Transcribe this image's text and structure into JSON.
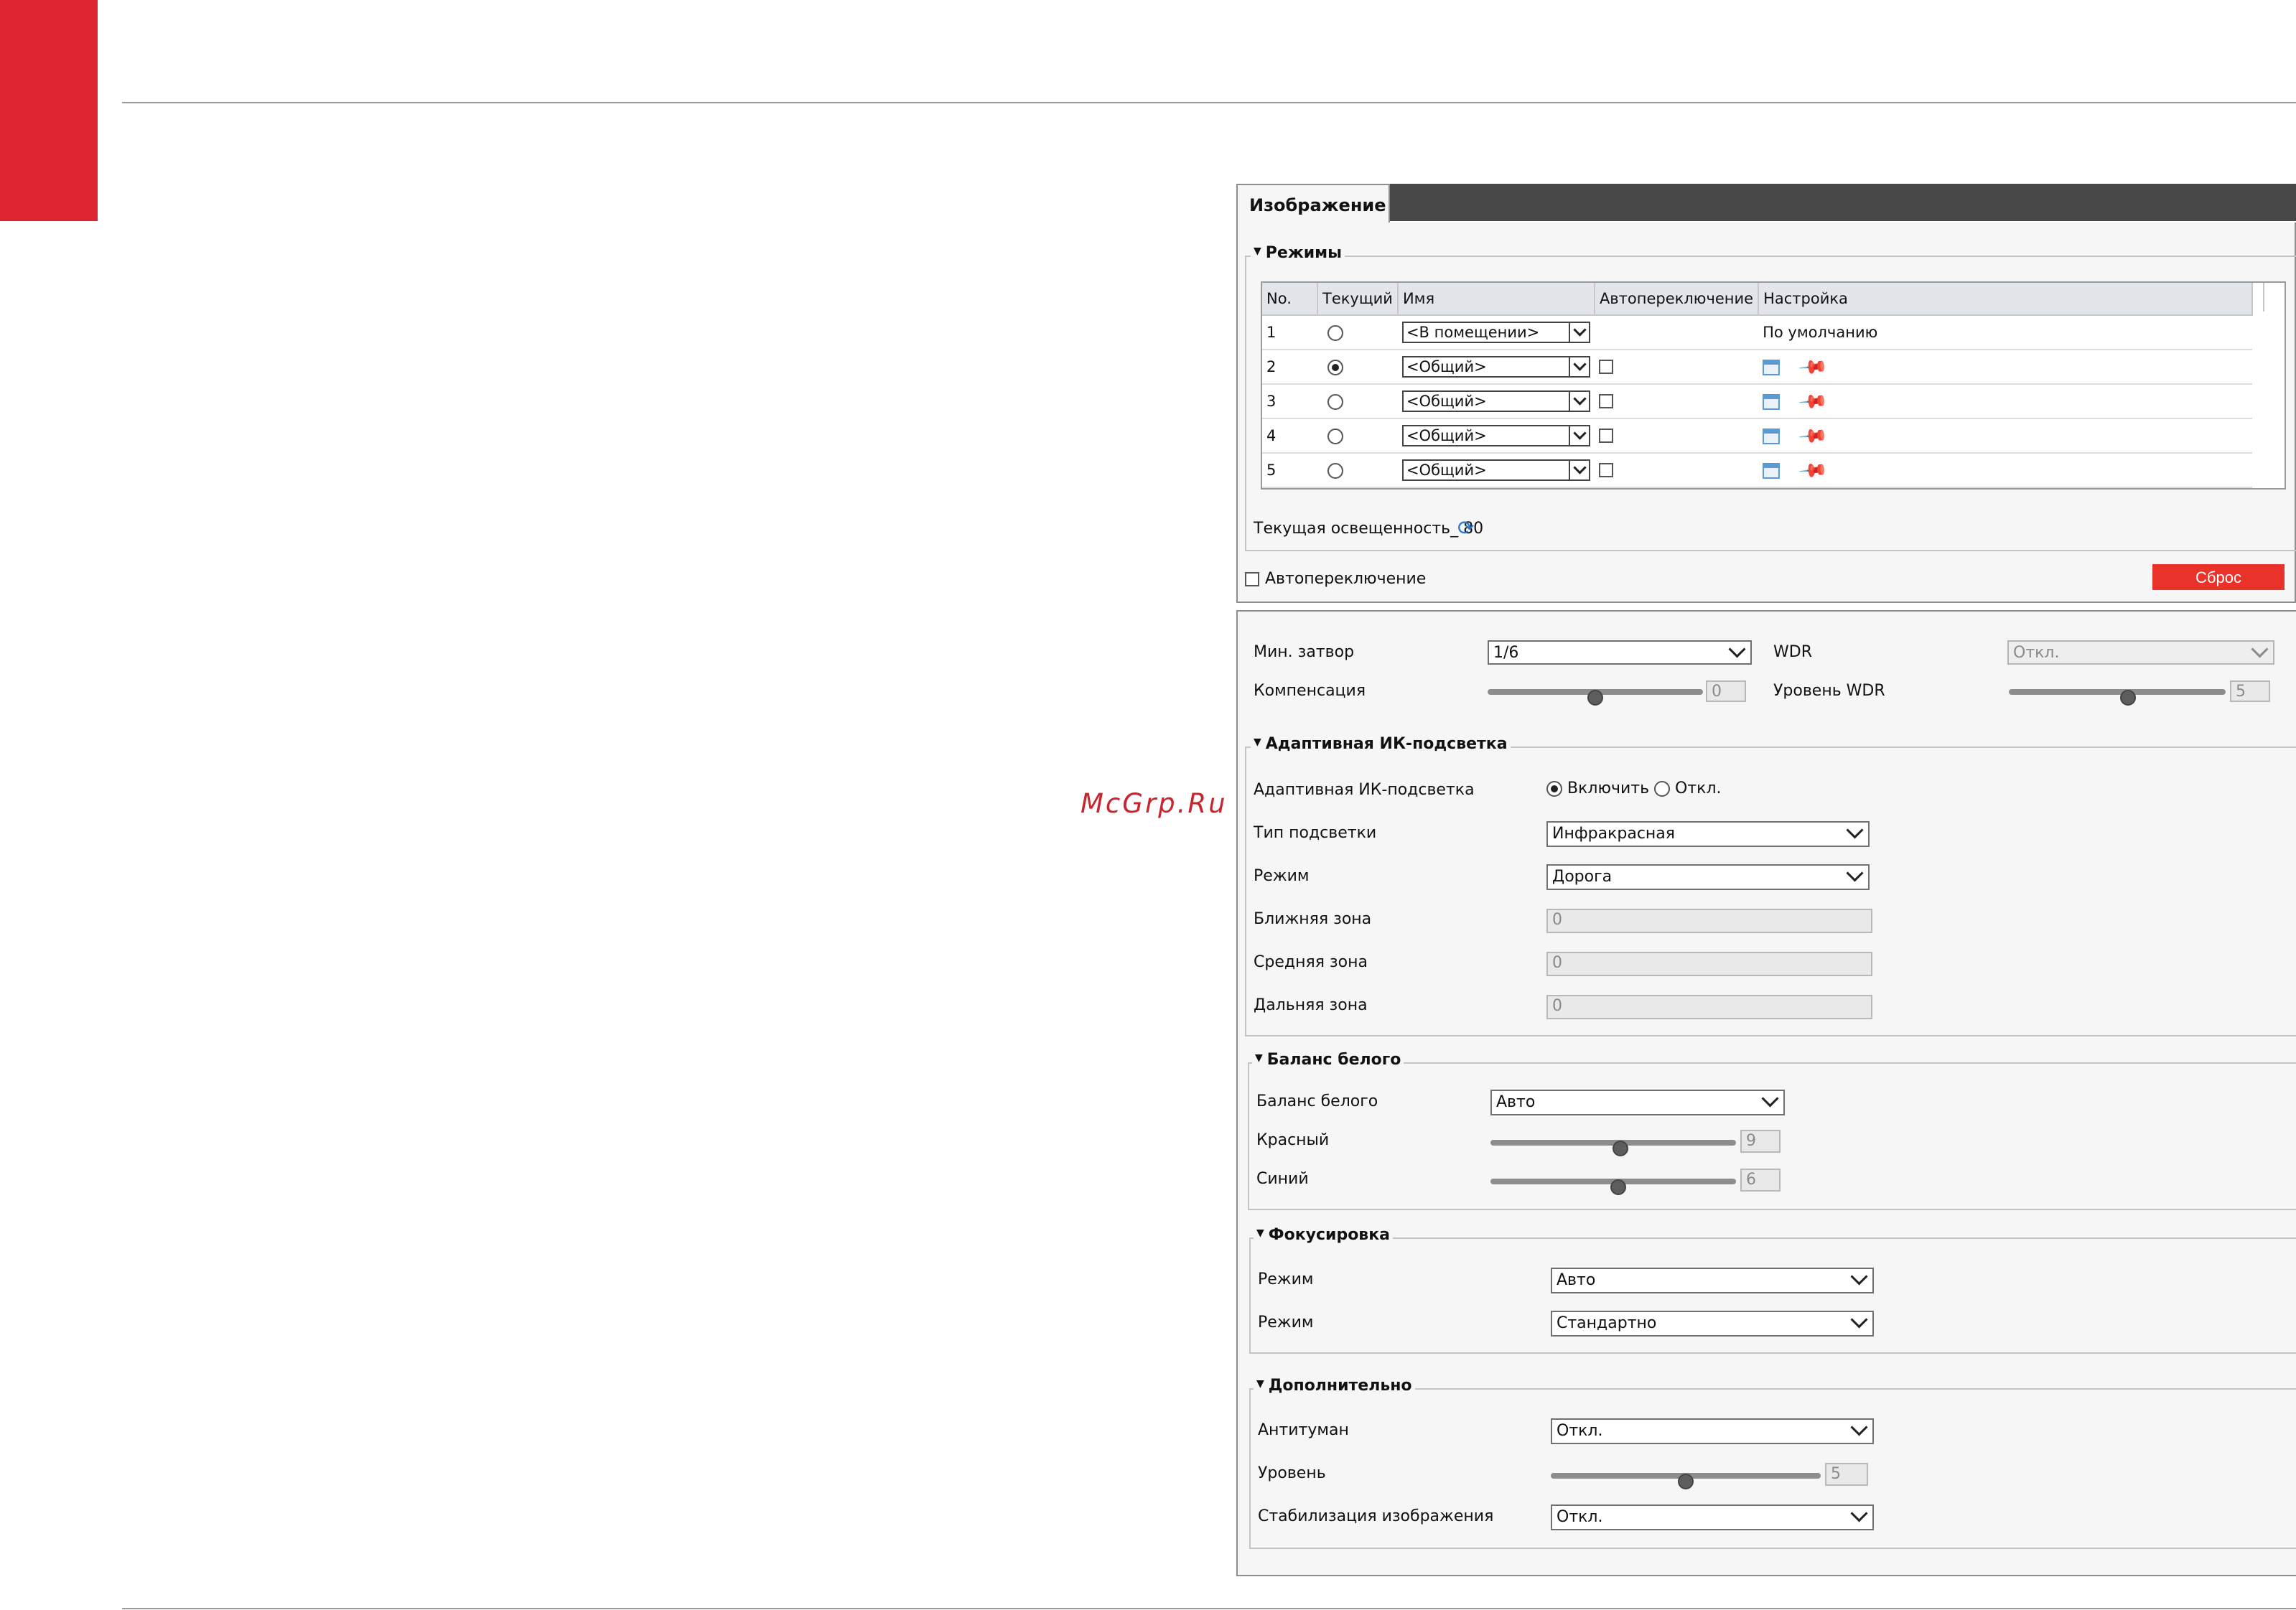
{
  "watermark": "McGrp.Ru",
  "window": {
    "tab_title": "Изображение"
  },
  "modes": {
    "legend": "Режимы",
    "columns": [
      "No.",
      "Текущий",
      "Имя",
      "Автопереключение",
      "Настройка"
    ],
    "rows": [
      {
        "no": "1",
        "current": false,
        "name": "<В помещении>",
        "auto": null,
        "setting_text": "По умолчанию",
        "icons": []
      },
      {
        "no": "2",
        "current": true,
        "name": "<Общий>",
        "auto": false,
        "setting_text": "",
        "icons": [
          "calendar-icon",
          "pin-icon"
        ]
      },
      {
        "no": "3",
        "current": false,
        "name": "<Общий>",
        "auto": false,
        "setting_text": "",
        "icons": [
          "calendar-icon",
          "pin-icon"
        ]
      },
      {
        "no": "4",
        "current": false,
        "name": "<Общий>",
        "auto": false,
        "setting_text": "",
        "icons": [
          "calendar-icon",
          "pin-icon"
        ]
      },
      {
        "no": "5",
        "current": false,
        "name": "<Общий>",
        "auto": false,
        "setting_text": "",
        "icons": [
          "calendar-icon",
          "pin-icon"
        ]
      }
    ],
    "illumination_label": "Текущая освещенность_",
    "illumination_value": "80",
    "autoswitch_label": "Автопереключение",
    "reset_label": "Сброс"
  },
  "exposure": {
    "min_shutter_label": "Мин. затвор",
    "min_shutter_value": "1/6",
    "compensation_label": "Компенсация",
    "compensation_value": "0",
    "compensation_level": 0.5,
    "wdr_label": "WDR",
    "wdr_value": "Откл.",
    "wdr_level_label": "Уровень WDR",
    "wdr_level_value": "5",
    "wdr_level": 0.55
  },
  "ir": {
    "legend": "Адаптивная ИК-подсветка",
    "adaptive_label": "Адаптивная ИК-подсветка",
    "on_label": "Включить",
    "off_label": "Откл.",
    "type_label": "Тип подсветки",
    "type_value": "Инфракрасная",
    "mode_label": "Режим",
    "mode_value": "Дорога",
    "near_label": "Ближняя зона",
    "near_value": "0",
    "mid_label": "Средняя зона",
    "mid_value": "0",
    "far_label": "Дальняя зона",
    "far_value": "0"
  },
  "wb": {
    "legend": "Баланс белого",
    "wb_label": "Баланс белого",
    "wb_value": "Авто",
    "red_label": "Красный",
    "red_value": "9",
    "red_level": 0.53,
    "blue_label": "Синий",
    "blue_value": "6",
    "blue_level": 0.52
  },
  "focus": {
    "legend": "Фокусировка",
    "mode1_label": "Режим",
    "mode1_value": "Авто",
    "mode2_label": "Режим",
    "mode2_value": "Стандартно"
  },
  "extra": {
    "legend": "Дополнительно",
    "defog_label": "Антитуман",
    "defog_value": "Откл.",
    "level_label": "Уровень",
    "level_value": "5",
    "level_level": 0.5,
    "stab_label": "Стабилизация изображения",
    "stab_value": "Откл."
  },
  "colors": {
    "accent": "#dc2530",
    "reset": "#e8322a",
    "tabbar": "#474747"
  }
}
